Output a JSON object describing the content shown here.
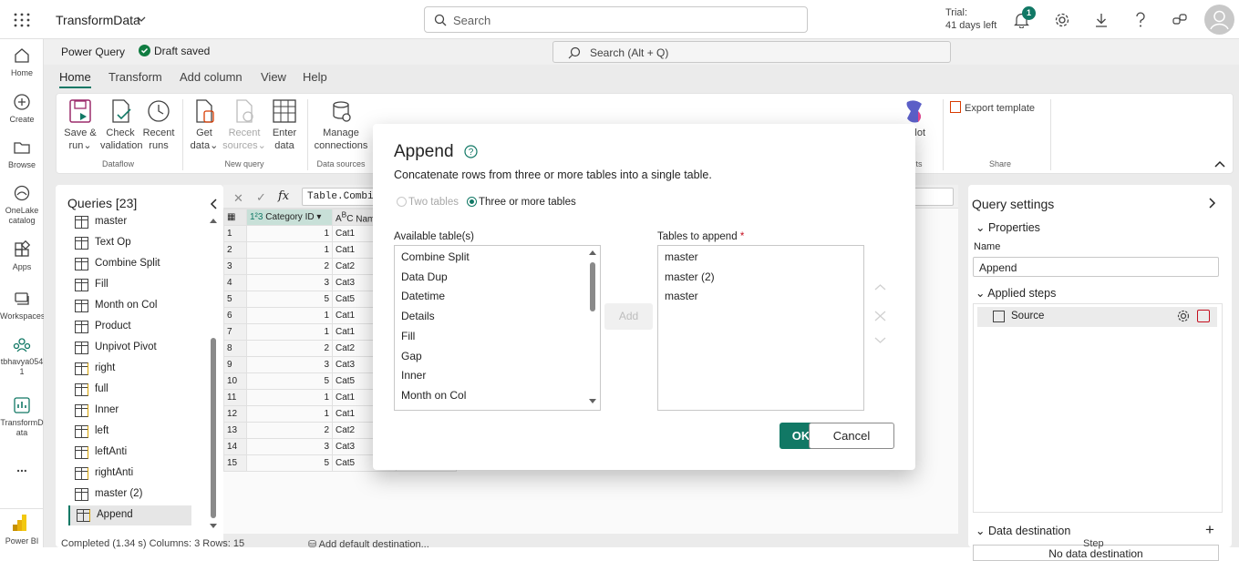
{
  "topbar": {
    "app_title": "TransformData",
    "search_placeholder": "Search",
    "trial_line1": "Trial:",
    "trial_line2": "41 days left",
    "notification_count": "1"
  },
  "rail": {
    "items": [
      {
        "label": "Home"
      },
      {
        "label": "Create"
      },
      {
        "label": "Browse"
      },
      {
        "label": "OneLake catalog"
      },
      {
        "label": "Apps"
      },
      {
        "label": "Workspaces"
      },
      {
        "label": "tbhavya054 1"
      },
      {
        "label": "TransformD ata"
      },
      {
        "label": "..."
      },
      {
        "label": "Power BI"
      }
    ]
  },
  "pq": {
    "title": "Power Query",
    "draft_status": "Draft saved",
    "search_placeholder": "Search (Alt + Q)",
    "tabs": [
      "Home",
      "Transform",
      "Add column",
      "View",
      "Help"
    ]
  },
  "ribbon": {
    "buttons": [
      {
        "l1": "Save &",
        "l2": "run"
      },
      {
        "l1": "Check",
        "l2": "validation"
      },
      {
        "l1": "Recent",
        "l2": "runs"
      },
      {
        "l1": "Get",
        "l2": "data"
      },
      {
        "l1": "Recent",
        "l2": "sources"
      },
      {
        "l1": "Enter",
        "l2": "data"
      },
      {
        "l1": "Manage",
        "l2": "connections"
      },
      {
        "l1": "",
        "l2": "ilot"
      },
      {
        "l1": "Export template",
        "l2": ""
      }
    ],
    "groups": [
      "Dataflow",
      "New query",
      "Data sources",
      "ghts",
      "Share"
    ]
  },
  "queries": {
    "title": "Queries [23]",
    "items": [
      {
        "label": "master"
      },
      {
        "label": "Text Op"
      },
      {
        "label": "Combine Split"
      },
      {
        "label": "Fill"
      },
      {
        "label": "Month on Col"
      },
      {
        "label": "Product"
      },
      {
        "label": "Unpivot Pivot"
      },
      {
        "label": "right"
      },
      {
        "label": "full"
      },
      {
        "label": "Inner"
      },
      {
        "label": "left"
      },
      {
        "label": "leftAnti"
      },
      {
        "label": "rightAnti"
      },
      {
        "label": "master (2)"
      },
      {
        "label": "Append"
      }
    ]
  },
  "grid": {
    "formula": "Table.Combin",
    "col1": "Category ID",
    "col2": "Nam",
    "rows": [
      {
        "n": "1",
        "id": "1",
        "cat": "Cat1"
      },
      {
        "n": "2",
        "id": "1",
        "cat": "Cat1"
      },
      {
        "n": "3",
        "id": "2",
        "cat": "Cat2"
      },
      {
        "n": "4",
        "id": "3",
        "cat": "Cat3"
      },
      {
        "n": "5",
        "id": "5",
        "cat": "Cat5"
      },
      {
        "n": "6",
        "id": "1",
        "cat": "Cat1"
      },
      {
        "n": "7",
        "id": "1",
        "cat": "Cat1"
      },
      {
        "n": "8",
        "id": "2",
        "cat": "Cat2"
      },
      {
        "n": "9",
        "id": "3",
        "cat": "Cat3"
      },
      {
        "n": "10",
        "id": "5",
        "cat": "Cat5"
      },
      {
        "n": "11",
        "id": "1",
        "cat": "Cat1"
      },
      {
        "n": "12",
        "id": "1",
        "cat": "Cat1"
      },
      {
        "n": "13",
        "id": "2",
        "cat": "Cat2"
      },
      {
        "n": "14",
        "id": "3",
        "cat": "Cat3"
      },
      {
        "n": "15",
        "id": "5",
        "cat": "Cat5",
        "extra": "null"
      }
    ]
  },
  "settings": {
    "title": "Query settings",
    "properties": "Properties",
    "name_label": "Name",
    "name_value": "Append",
    "applied_steps": "Applied steps",
    "step_source": "Source",
    "data_destination": "Data destination",
    "no_destination": "No data destination"
  },
  "status": {
    "text": "Completed (1.34 s)    Columns: 3    Rows: 15",
    "add_dest": "Add default destination...",
    "step": "Step"
  },
  "dialog": {
    "title": "Append",
    "description": "Concatenate rows from three or more tables into a single table.",
    "radio_two": "Two tables",
    "radio_three": "Three or more tables",
    "available_label": "Available table(s)",
    "append_label": "Tables to append",
    "required_mark": "*",
    "available": [
      "Combine Split",
      "Data Dup",
      "Datetime",
      "Details",
      "Fill",
      "Gap",
      "Inner",
      "Month on Col"
    ],
    "to_append": [
      "master",
      "master (2)",
      "master"
    ],
    "add_label": "Add",
    "ok_label": "OK",
    "cancel_label": "Cancel"
  },
  "colors": {
    "accent": "#117865"
  }
}
